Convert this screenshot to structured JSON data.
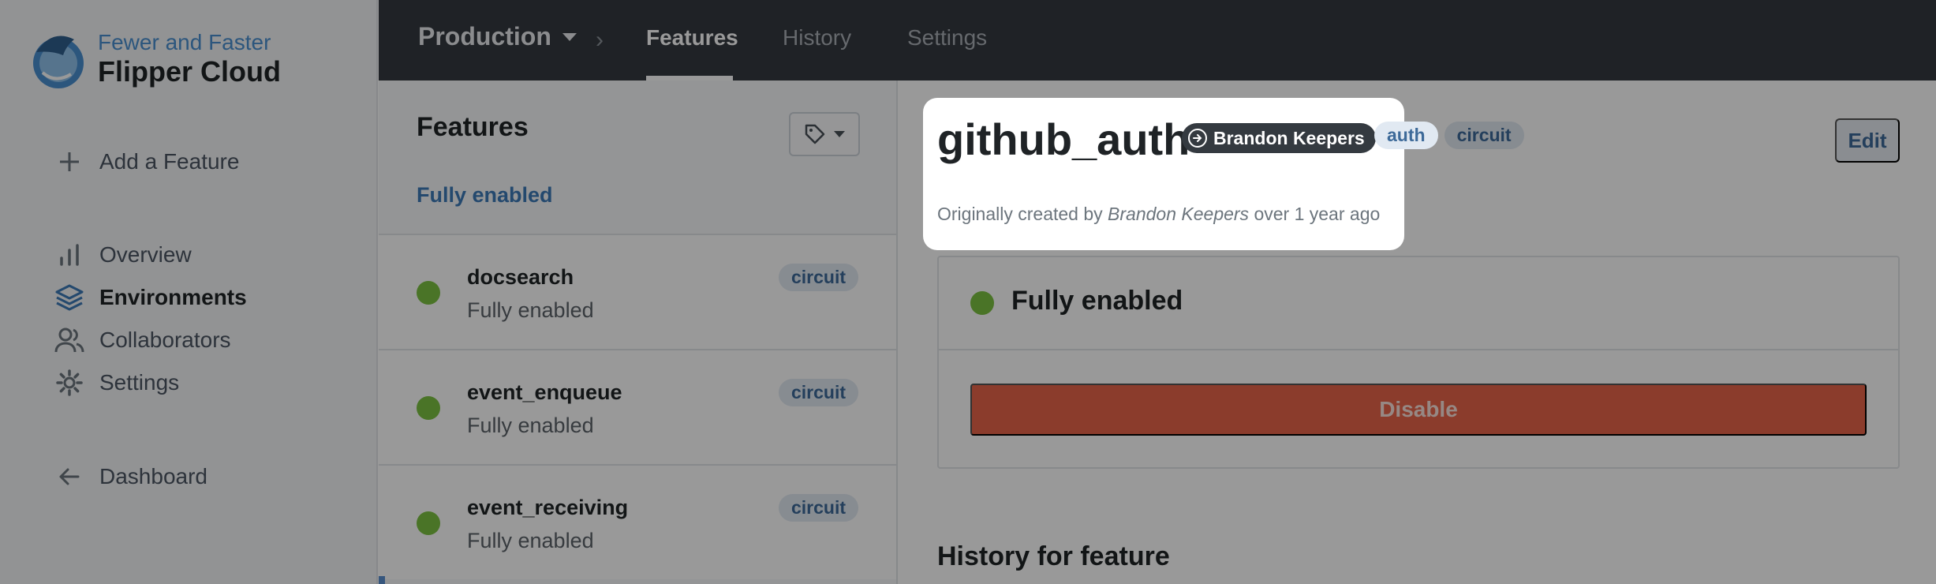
{
  "sidebar": {
    "tagline": "Fewer and Faster",
    "brand": "Flipper Cloud",
    "add_feature": "Add a Feature",
    "nav": [
      {
        "label": "Overview",
        "icon": "bar-chart-icon"
      },
      {
        "label": "Environments",
        "icon": "layers-icon",
        "active": true
      },
      {
        "label": "Collaborators",
        "icon": "users-icon"
      },
      {
        "label": "Settings",
        "icon": "gear-icon"
      }
    ],
    "back": "Dashboard"
  },
  "topnav": {
    "environment": "Production",
    "tabs": [
      {
        "label": "Features",
        "active": true
      },
      {
        "label": "History"
      },
      {
        "label": "Settings"
      }
    ]
  },
  "features_panel": {
    "title": "Features",
    "filter": "Fully enabled",
    "items": [
      {
        "name": "docsearch",
        "status": "Fully enabled",
        "tag": "circuit"
      },
      {
        "name": "event_enqueue",
        "status": "Fully enabled",
        "tag": "circuit"
      },
      {
        "name": "event_receiving",
        "status": "Fully enabled",
        "tag": "circuit"
      }
    ]
  },
  "feature": {
    "name": "github_auth",
    "author_badge": "Brandon Keepers",
    "tags": [
      "auth",
      "circuit"
    ],
    "created_prefix": "Originally created by",
    "created_by": "Brandon Keepers",
    "created_suffix": "over 1 year ago",
    "edit_label": "Edit",
    "status_label": "Fully enabled",
    "disable_label": "Disable",
    "history_title": "History for feature"
  },
  "colors": {
    "enabled_dot": "#7cc242",
    "disable_button": "#e8644a",
    "topnav": "#343a40",
    "accent": "#3d7ab8"
  }
}
